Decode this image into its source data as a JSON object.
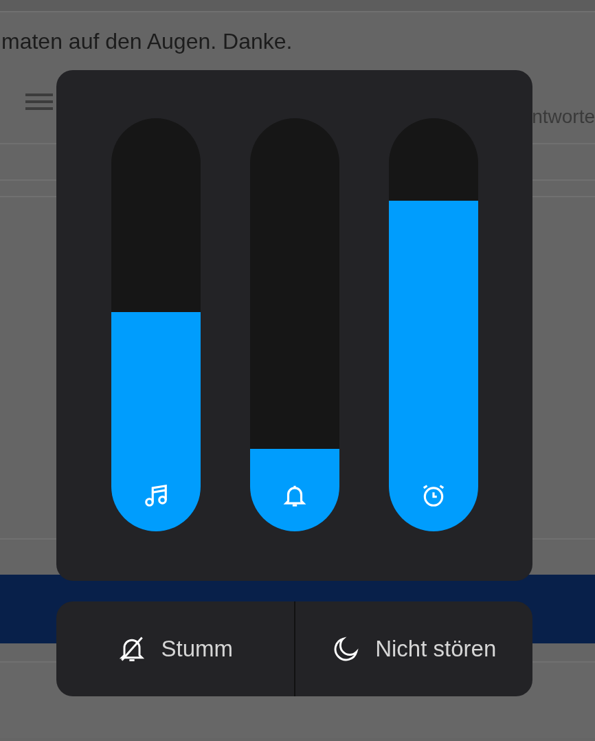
{
  "background": {
    "message": "maten auf den Augen. Danke.",
    "tab_label": "ntworte"
  },
  "volume_panel": {
    "sliders": [
      {
        "kind": "music",
        "level": 0.53
      },
      {
        "kind": "ring",
        "level": 0.2
      },
      {
        "kind": "alarm",
        "level": 0.8
      }
    ]
  },
  "mode_buttons": [
    {
      "kind": "mute",
      "label": "Stumm"
    },
    {
      "kind": "dnd",
      "label": "Nicht stören"
    }
  ]
}
